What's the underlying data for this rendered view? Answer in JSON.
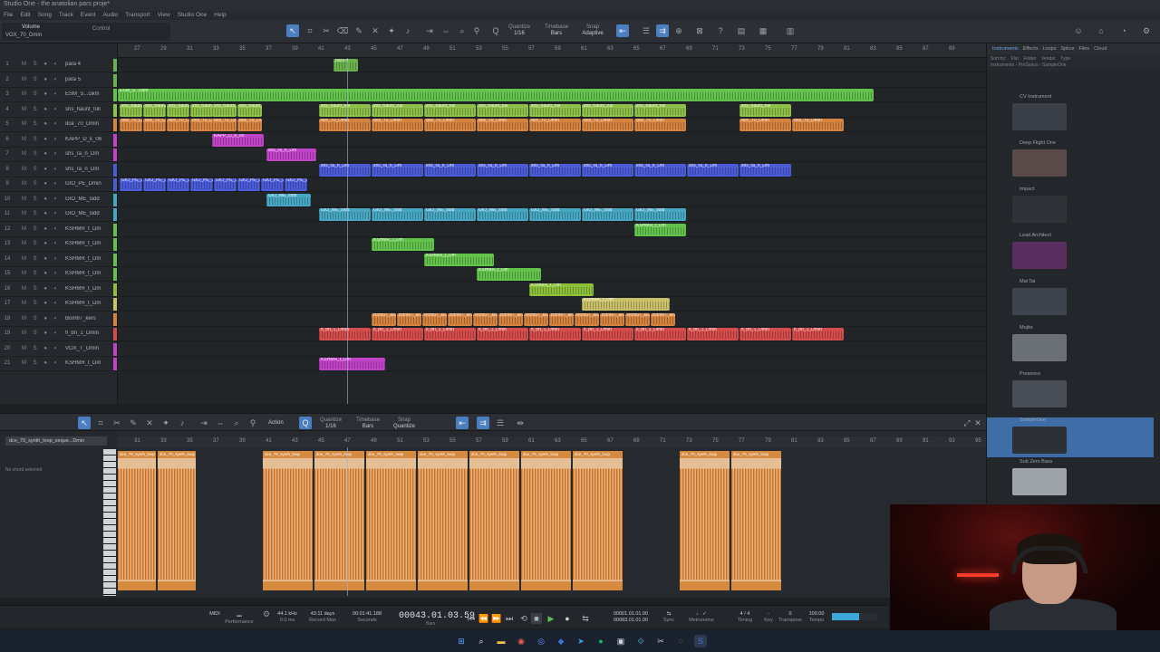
{
  "window": {
    "title": "Studio One - the anatolian pars proje*"
  },
  "menu": [
    "File",
    "Edit",
    "Song",
    "Track",
    "Event",
    "Audio",
    "Transport",
    "View",
    "Studio One",
    "Help"
  ],
  "toolbar": {
    "track_label": "Volume",
    "track_value": "VOX_70_Dmin",
    "control_label": "Control",
    "quantize_label": "Quantize",
    "quantize_value": "1/16",
    "timebase_label": "Timebase",
    "timebase_value": "Bars",
    "snap_label": "Snap",
    "snap_value": "Adaptive"
  },
  "tracks": [
    {
      "n": "1",
      "name": "para 4",
      "color": "#6ab04c"
    },
    {
      "n": "2",
      "name": "para 5",
      "color": "#6ab04c"
    },
    {
      "n": "3",
      "name": "ESM_S...cikm",
      "color": "#63c24b"
    },
    {
      "n": "4",
      "name": "shs_haunt_full",
      "color": "#8ec04a"
    },
    {
      "n": "5",
      "name": "dce_70_Dmin",
      "color": "#d5833f"
    },
    {
      "n": "6",
      "name": "KAPP_D_k_06",
      "color": "#c043c8"
    },
    {
      "n": "7",
      "name": "shs_ra_n_Dm",
      "color": "#c043c8"
    },
    {
      "n": "8",
      "name": "shs_ra_n_Dm",
      "color": "#4c5bd8"
    },
    {
      "n": "9",
      "name": "GIO_PE_Dmin",
      "color": "#4c5bd8"
    },
    {
      "n": "10",
      "name": "GIO_ME_sidd",
      "color": "#47a7c2"
    },
    {
      "n": "11",
      "name": "GIO_ME_sidd",
      "color": "#47a7c2"
    },
    {
      "n": "12",
      "name": "KSHMR_t_Dm",
      "color": "#63c24b"
    },
    {
      "n": "13",
      "name": "KSHMR_t_Dm",
      "color": "#63c24b"
    },
    {
      "n": "14",
      "name": "KSHMR_t_Dm",
      "color": "#63c24b"
    },
    {
      "n": "15",
      "name": "KSHMR_t_Dm",
      "color": "#63c24b"
    },
    {
      "n": "16",
      "name": "KSHMR_t_Dm",
      "color": "#8cbf3a"
    },
    {
      "n": "17",
      "name": "KSHMR_t_Dm",
      "color": "#c9c06a"
    },
    {
      "n": "18",
      "name": "Bom87_kers",
      "color": "#d5833f"
    },
    {
      "n": "19",
      "name": "fl_bri_1_Dmin",
      "color": "#d44c4c"
    },
    {
      "n": "20",
      "name": "VOX_T_Dmin",
      "color": "#c043c8"
    },
    {
      "n": "21",
      "name": "KSHMR_t_Dm",
      "color": "#c043c8"
    }
  ],
  "ruler": [
    "27",
    "29",
    "31",
    "33",
    "35",
    "37",
    "39",
    "41",
    "43",
    "45",
    "47",
    "49",
    "51",
    "53",
    "55",
    "57",
    "59",
    "61",
    "63",
    "65",
    "67",
    "69",
    "71",
    "73",
    "75",
    "77",
    "79",
    "81",
    "83",
    "85",
    "87",
    "89"
  ],
  "browser": {
    "tabs": [
      "Instruments",
      "Effects",
      "Loops",
      "Splice",
      "Files",
      "Cloud"
    ],
    "active_tab": "Instruments",
    "sort_by": "Sort by:",
    "sort_options": [
      "Flat",
      "Folder",
      "Vendor",
      "Type"
    ],
    "path": [
      "Instruments",
      "PreSonus",
      "SampleOne"
    ],
    "plugins": [
      {
        "name": "CV Instrument",
        "thumb": "#3b4048"
      },
      {
        "name": "Deep Flight One",
        "thumb": "#5a4a4a"
      },
      {
        "name": "Impact",
        "thumb": "#2f3236"
      },
      {
        "name": "Lead Architect",
        "thumb": "#5b2e60"
      },
      {
        "name": "Mai Tai",
        "thumb": "#3d444d"
      },
      {
        "name": "Mojito",
        "thumb": "#6c7077"
      },
      {
        "name": "Presence",
        "thumb": "#4a4f57"
      },
      {
        "name": "SampleOne",
        "thumb": "#2d3136",
        "selected": true
      },
      {
        "name": "Sub Zero Bass",
        "thumb": "#9ea3aa"
      }
    ]
  },
  "editor": {
    "action_label": "Action",
    "quantize_label": "Quantize",
    "quantize_value": "1/16",
    "timebase_label": "Timebase",
    "timebase_value": "Bars",
    "snap_label": "Snap",
    "snap_value": "Quantize",
    "track_name": "dce_70_synth_loop_seque...Dmin",
    "chord_status": "No chord selected",
    "ruler": [
      "31",
      "33",
      "35",
      "37",
      "39",
      "41",
      "43",
      "45",
      "47",
      "49",
      "51",
      "53",
      "55",
      "57",
      "59",
      "61",
      "63",
      "65",
      "67",
      "69",
      "71",
      "73",
      "75",
      "77",
      "79",
      "81",
      "83",
      "85",
      "87",
      "89",
      "91",
      "93",
      "95"
    ],
    "clip_label": "dce_70_synth_loop"
  },
  "transport": {
    "midi": "MIDI",
    "performance": "Performance",
    "sample_rate": "44.1 kHz",
    "latency": "0.0 ms",
    "record_time": "43:11 days",
    "record_max": "Record Max",
    "seconds_time": "00:01:41.188",
    "seconds_label": "Seconds",
    "bars_time": "00043.01.03.59",
    "bars_label": "Bars",
    "loop_start": "00001.01.01.00",
    "loop_end": "00083.01.01.00",
    "sync": "Sync",
    "metronome": "Metronome",
    "signature": "4 / 4",
    "timing": "Timing",
    "key": "-",
    "key_label": "Key",
    "transpose": "0",
    "transpose_label": "Transpose",
    "tempo": "100.00",
    "tempo_label": "Tempo"
  },
  "colors": {
    "accent": "#4b7fbf",
    "green": "#63c24b",
    "orange": "#d5833f",
    "magenta": "#c043c8",
    "blue": "#4c5bd8",
    "red": "#d44c4c"
  }
}
